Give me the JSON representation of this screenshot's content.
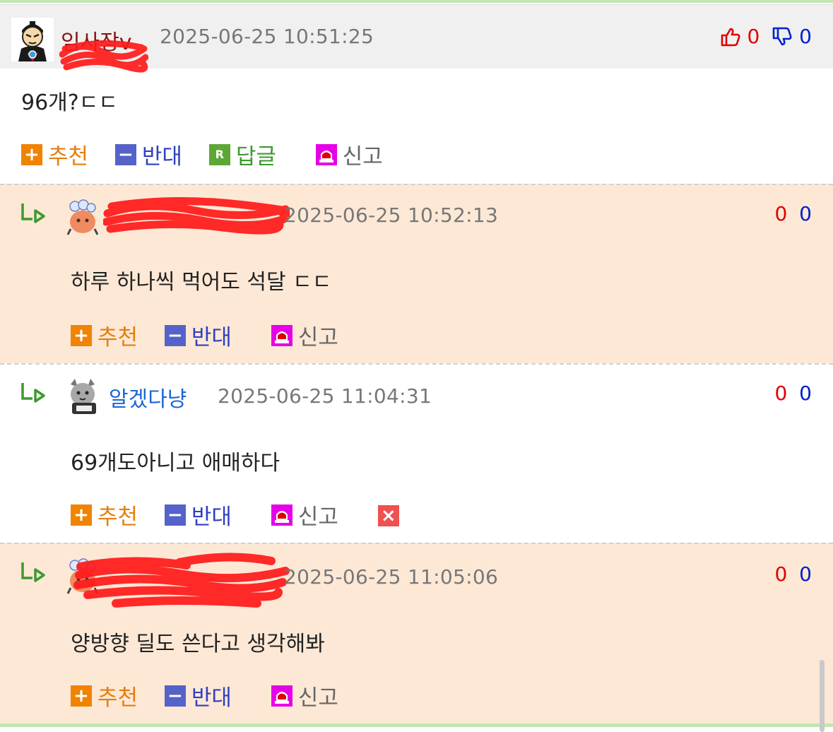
{
  "main_comment": {
    "nickname": "임사장v",
    "timestamp": "2025-06-25 10:51:25",
    "up_count": "0",
    "down_count": "0",
    "body": "96개?ㄷㄷ",
    "actions": {
      "recommend": "추천",
      "oppose": "반대",
      "reply": "답글",
      "report": "신고"
    }
  },
  "replies": [
    {
      "nickname": "",
      "timestamp": "2025-06-25 10:52:13",
      "up_count": "0",
      "down_count": "0",
      "body": "하루 하나씩 먹어도 석달 ㄷㄷ",
      "actions": {
        "recommend": "추천",
        "oppose": "반대",
        "report": "신고"
      }
    },
    {
      "nickname": "알겠다냥",
      "timestamp": "2025-06-25 11:04:31",
      "up_count": "0",
      "down_count": "0",
      "body": "69개도아니고 애매하다",
      "actions": {
        "recommend": "추천",
        "oppose": "반대",
        "report": "신고"
      }
    },
    {
      "nickname": "",
      "timestamp": "2025-06-25 11:05:06",
      "up_count": "0",
      "down_count": "0",
      "body": "양방향 딜도 쓴다고 생각해봐",
      "actions": {
        "recommend": "추천",
        "oppose": "반대",
        "report": "신고"
      }
    }
  ],
  "icons": {
    "recommend": "plus-icon",
    "oppose": "minus-icon",
    "reply": "reply-r-icon",
    "report": "siren-icon",
    "delete": "close-icon",
    "thumbs_up": "thumbs-up-icon",
    "thumbs_down": "thumbs-down-icon",
    "reply_arrow": "reply-arrow-icon"
  },
  "colors": {
    "header_bg": "#f0f0f0",
    "reply_bg": "#fde8d6",
    "up": "#e00000",
    "down": "#0022cc",
    "recommend": "#e67e0b",
    "oppose": "#3040c0",
    "reply": "#3c9a2e"
  }
}
